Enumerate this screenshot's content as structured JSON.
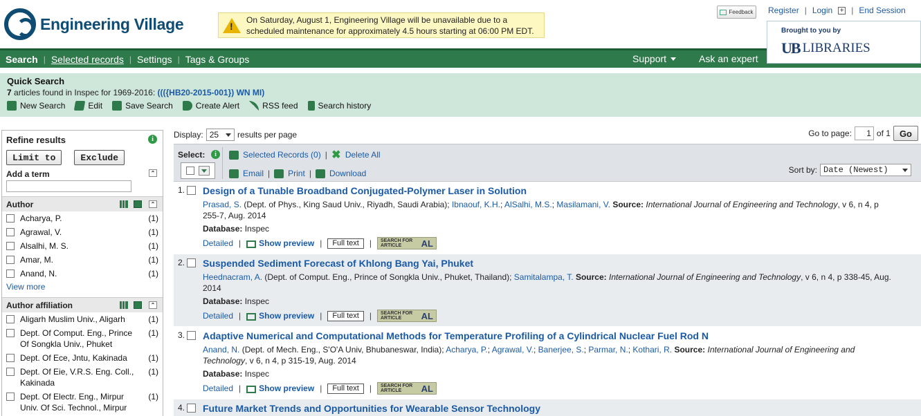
{
  "header": {
    "logo_text": "Engineering Village",
    "alert_text": "On Saturday, August 1, Engineering Village will be unavailable due to a scheduled maintenance for approximately 4.5 hours starting at 06:00 PM EDT.",
    "feedback_label": "Feedback",
    "register": "Register",
    "login": "Login",
    "end_session": "End Session",
    "brought_by": "Brought to you by",
    "library_logo": "UB",
    "library_name": "LIBRARIES"
  },
  "nav": {
    "search": "Search",
    "selected_records": "Selected records",
    "settings": "Settings",
    "tags_groups": "Tags & Groups",
    "support": "Support",
    "ask_expert": "Ask an expert"
  },
  "quick_search": {
    "title": "Quick Search",
    "count": "7",
    "found_text": "articles found in Inspec for 1969-2016:",
    "query": "((({HB20-2015-001}) WN MI)",
    "actions": [
      "New Search",
      "Edit",
      "Save Search",
      "Create Alert",
      "RSS feed",
      "Search history"
    ]
  },
  "refine": {
    "title": "Refine results",
    "limit_to": "Limit to",
    "exclude": "Exclude",
    "add_term": "Add a term",
    "author_title": "Author",
    "authors": [
      {
        "name": "Acharya, P.",
        "count": "(1)"
      },
      {
        "name": "Agrawal, V.",
        "count": "(1)"
      },
      {
        "name": "Alsalhi, M. S.",
        "count": "(1)"
      },
      {
        "name": "Amar, M.",
        "count": "(1)"
      },
      {
        "name": "Anand, N.",
        "count": "(1)"
      }
    ],
    "view_more": "View more",
    "affiliation_title": "Author affiliation",
    "affiliations": [
      {
        "name": "Aligarh Muslim Univ., Aligarh",
        "count": "(1)"
      },
      {
        "name": "Dept. Of Comput. Eng., Prince Of Songkla Univ., Phuket",
        "count": "(1)"
      },
      {
        "name": "Dept. Of Ece, Jntu, Kakinada",
        "count": "(1)"
      },
      {
        "name": "Dept. Of Eie, V.R.S. Eng. Coll., Kakinada",
        "count": "(1)"
      },
      {
        "name": "Dept. Of Electr. Eng., Mirpur Univ. Of Sci. Technol., Mirpur",
        "count": "(1)"
      }
    ]
  },
  "display": {
    "label": "Display:",
    "per_page": "25",
    "suffix": "results per page",
    "goto": "Go to page:",
    "page": "1",
    "of": "of 1",
    "go": "Go"
  },
  "toolbar": {
    "select": "Select:",
    "selected_records": "Selected Records (0)",
    "delete_all": "Delete All",
    "email": "Email",
    "print": "Print",
    "download": "Download",
    "sort_by": "Sort by:",
    "sort_value": "Date (Newest)"
  },
  "results": [
    {
      "num": "1.",
      "title": "Design of a Tunable Broadband Conjugated-Polymer Laser in Solution",
      "authors": [
        {
          "name": "Prasad, S.",
          "aff": " (Dept. of Phys., King Saud Univ., Riyadh, Saudi Arabia); "
        },
        {
          "name": "Ibnaouf, K.H.",
          "aff": "; "
        },
        {
          "name": "AlSalhi, M.S.",
          "aff": "; "
        },
        {
          "name": "Masilamani, V.",
          "aff": " "
        }
      ],
      "source_label": "Source:",
      "journal": "International Journal of Engineering and Technology",
      "citation": ", v 6, n 4, p 255-7, Aug. 2014",
      "db_label": "Database:",
      "db": "Inspec"
    },
    {
      "num": "2.",
      "title": "Suspended Sediment Forecast of Khlong Bang Yai, Phuket",
      "authors": [
        {
          "name": "Heednacram, A.",
          "aff": " (Dept. of Comput. Eng., Prince of Songkla Univ., Phuket, Thailand); "
        },
        {
          "name": "Samitalampa, T.",
          "aff": " "
        }
      ],
      "source_label": "Source:",
      "journal": "International Journal of Engineering and Technology",
      "citation": ", v 6, n 4, p 338-45, Aug. 2014",
      "db_label": "Database:",
      "db": "Inspec"
    },
    {
      "num": "3.",
      "title": "Adaptive Numerical and Computational Methods for Temperature Profiling of a Cylindrical Nuclear Fuel Rod N",
      "authors": [
        {
          "name": "Anand, N.",
          "aff": " (Dept. of Mech. Eng., S'O'A Univ, Bhubaneswar, India); "
        },
        {
          "name": "Acharya, P.",
          "aff": "; "
        },
        {
          "name": "Agrawal, V.",
          "aff": "; "
        },
        {
          "name": "Banerjee, S.",
          "aff": "; "
        },
        {
          "name": "Parmar, N.",
          "aff": "; "
        },
        {
          "name": "Kothari, R.",
          "aff": " "
        }
      ],
      "source_label": "Source:",
      "journal": "International Journal of Engineering and Technology",
      "citation": ", v 6, n 4, p 315-19, Aug. 2014",
      "db_label": "Database:",
      "db": "Inspec"
    },
    {
      "num": "4.",
      "title": "Future Market Trends and Opportunities for Wearable Sensor Technology",
      "authors": [],
      "source_label": "",
      "journal": "",
      "citation": "",
      "db_label": "",
      "db": ""
    }
  ],
  "result_links": {
    "detailed": "Detailed",
    "show_preview": "Show preview",
    "full_text": "Full text",
    "sfa_top": "SEARCH FOR",
    "sfa_bottom": "ARTICLE",
    "sfa_logo": "AL"
  },
  "colors": {
    "brand_green": "#2e7a4b",
    "link_blue": "#1a5aa6",
    "quick_bg": "#cfe6da",
    "alert_bg": "#fdf7c2"
  }
}
